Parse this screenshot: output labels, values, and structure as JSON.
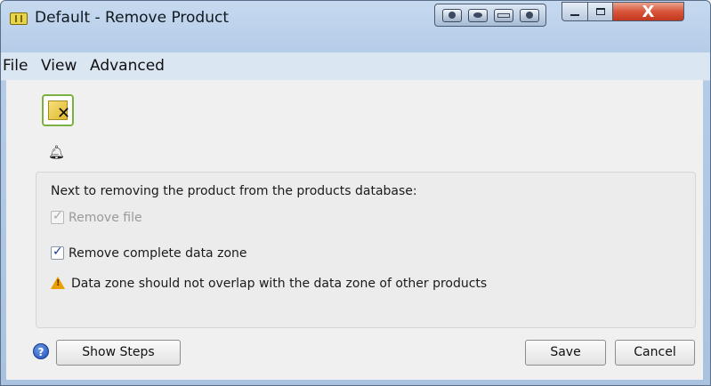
{
  "window": {
    "title": "Default - Remove Product",
    "close_glyph": "X"
  },
  "menubar": {
    "items": [
      {
        "label": "File"
      },
      {
        "label": "View"
      },
      {
        "label": "Advanced"
      }
    ]
  },
  "toolbar": {
    "action_icon": "remove-product-icon",
    "bell_icon": "bell-icon"
  },
  "panel": {
    "intro_text": "Next to removing the product from the products database:",
    "remove_file": {
      "label": "Remove file",
      "checked": true,
      "enabled": false
    },
    "remove_zone": {
      "label": "Remove complete data zone",
      "checked": true,
      "enabled": true
    },
    "warning_text": "Data zone should not overlap with the data zone of other products"
  },
  "footer": {
    "help_glyph": "?",
    "show_steps_label": "Show Steps",
    "save_label": "Save",
    "cancel_label": "Cancel"
  },
  "colors": {
    "titlebar": "#b4cce8",
    "menubar": "#dbe6f3",
    "close_button": "#d8543a",
    "action_border": "#7bb141",
    "warning": "#e8a000"
  }
}
